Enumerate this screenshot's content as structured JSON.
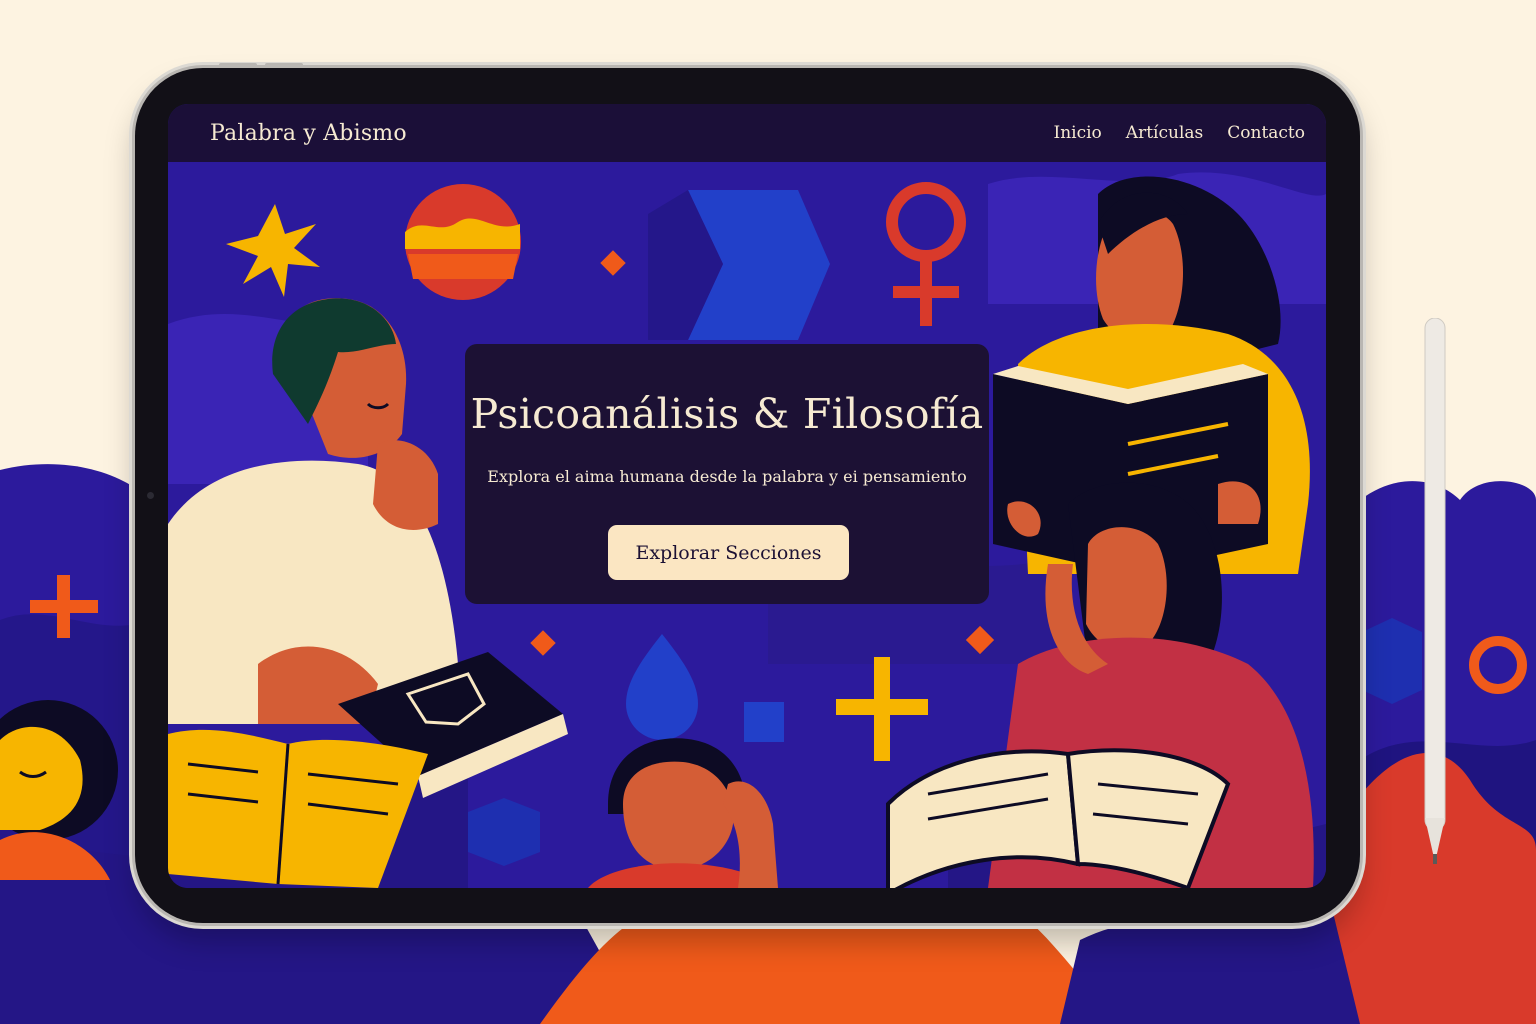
{
  "app": {
    "brand": "Palabra y Abismo",
    "nav": [
      {
        "label": "Inicio"
      },
      {
        "label": "Artículas"
      },
      {
        "label": "Contacto"
      }
    ]
  },
  "hero": {
    "title": "Psicoanálisis & Filosofía",
    "subtitle": "Explora el aima humana desde la palabra y ei pensamiento",
    "button_label": "Explorar Secciones"
  },
  "colors": {
    "page_background": "#fdf3e1",
    "screen_background": "#2c1a9c",
    "navbar": "#1b0f38",
    "hero_card": "#1c1134",
    "button": "#fbe6c2",
    "accent_yellow": "#f7b500",
    "accent_orange": "#f05a1a",
    "accent_red": "#d93a2b",
    "accent_blue": "#2240c9",
    "text_light": "#f6ead2"
  },
  "icons": [
    "star-icon",
    "venus-symbol-icon",
    "plus-icon",
    "circle-icon",
    "diamond-icon",
    "drop-icon",
    "cube-icon",
    "arrow-shape-icon",
    "sun-planet-icon"
  ]
}
